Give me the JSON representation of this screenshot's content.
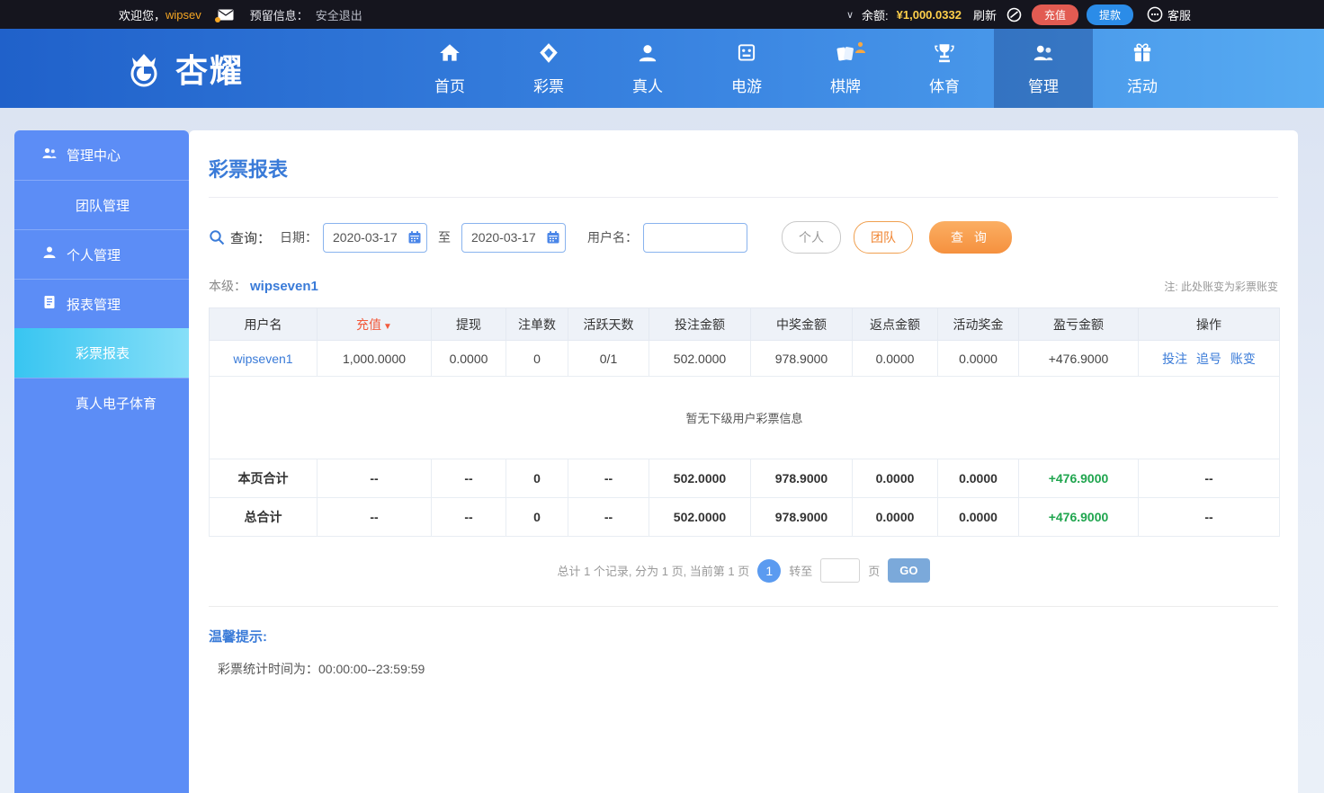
{
  "topbar": {
    "welcome_prefix": "欢迎您，",
    "username": "wipsev",
    "envelope_icon": "envelope-icon",
    "reserved_label": "预留信息：",
    "logout_label": "安全退出",
    "chevron": "∨",
    "balance_label": "余额:",
    "balance_value": "¥1,000.0332",
    "refresh_label": "刷新",
    "visibility_icon": "eye-slash-icon",
    "recharge_label": "充值",
    "withdraw_label": "提款",
    "service_label": "客服",
    "colors": {
      "bar_bg": "#15151e",
      "username": "#f5a623",
      "balance": "#ffd04a",
      "recharge_btn": "#e25b52",
      "withdraw_btn": "#2b8ce8"
    }
  },
  "nav": {
    "logo_text": "杏耀",
    "items": [
      {
        "label": "首页",
        "icon": "home-icon",
        "active": false
      },
      {
        "label": "彩票",
        "icon": "lottery-icon",
        "active": false
      },
      {
        "label": "真人",
        "icon": "live-person-icon",
        "active": false
      },
      {
        "label": "电游",
        "icon": "egames-icon",
        "active": false
      },
      {
        "label": "棋牌",
        "icon": "cards-icon",
        "active": false,
        "badge": "hot-person-badge"
      },
      {
        "label": "体育",
        "icon": "trophy-icon",
        "active": false
      },
      {
        "label": "管理",
        "icon": "manage-people-icon",
        "active": true
      },
      {
        "label": "活动",
        "icon": "gift-icon",
        "active": false
      }
    ],
    "colors": {
      "bar_gradient_start": "#2061ca",
      "bar_gradient_end": "#57abf2"
    }
  },
  "sidebar": {
    "items": [
      {
        "label": "管理中心",
        "icon": "team-icon",
        "type": "section",
        "active": false
      },
      {
        "label": "团队管理",
        "type": "sub",
        "active": false
      },
      {
        "label": "个人管理",
        "icon": "person-icon",
        "type": "section",
        "active": false
      },
      {
        "label": "报表管理",
        "icon": "report-icon",
        "type": "section",
        "active": false
      },
      {
        "label": "彩票报表",
        "type": "sub",
        "active": true
      },
      {
        "label": "真人电子体育",
        "type": "sub",
        "active": false
      }
    ],
    "colors": {
      "bg": "#5c8df6",
      "active_gradient": "#38c5f1"
    }
  },
  "main": {
    "title": "彩票报表",
    "query": {
      "search_icon": "search-icon",
      "label": "查询：",
      "date_label": "日期：",
      "date_from": "2020-03-17",
      "to_label": "至",
      "date_to": "2020-03-17",
      "calendar_icon": "calendar-icon",
      "username_label": "用户名：",
      "username_value": "",
      "btn_personal": "个人",
      "btn_team": "团队",
      "btn_search": "查 询"
    },
    "level_label": "本级：",
    "level_user": "wipseven1",
    "note": "注: 此处账变为彩票账变",
    "table": {
      "headers": [
        "用户名",
        "充值",
        "提现",
        "注单数",
        "活跃天数",
        "投注金额",
        "中奖金额",
        "返点金额",
        "活动奖金",
        "盈亏金额",
        "操作"
      ],
      "sort_icon": "▼",
      "rows": [
        {
          "username": "wipseven1",
          "recharge": "1,000.0000",
          "withdraw": "0.0000",
          "bet_count": "0",
          "active_days": "0/1",
          "bet_amount": "502.0000",
          "win_amount": "978.9000",
          "rebate": "0.0000",
          "activity_bonus": "0.0000",
          "profit": "+476.9000",
          "action_bet": "投注",
          "action_chase": "追号",
          "action_change": "账变"
        }
      ],
      "empty_text": "暂无下级用户彩票信息",
      "page_total": {
        "label": "本页合计",
        "cells": [
          "--",
          "--",
          "0",
          "--",
          "502.0000",
          "978.9000",
          "0.0000",
          "0.0000",
          "+476.9000",
          "--"
        ]
      },
      "grand_total": {
        "label": "总合计",
        "cells": [
          "--",
          "--",
          "0",
          "--",
          "502.0000",
          "978.9000",
          "0.0000",
          "0.0000",
          "+476.9000",
          "--"
        ]
      },
      "colors": {
        "header_bg": "#eef2f8",
        "profit_green": "#1fa54e",
        "sort_orange": "#f25a3c",
        "link_blue": "#3a7bd8"
      }
    },
    "pagination": {
      "summary": "总计 1 个记录, 分为 1 页, 当前第 1 页",
      "current_page": "1",
      "goto_label": "转至",
      "goto_value": "",
      "page_label": "页",
      "go_label": "GO"
    },
    "tips": {
      "title": "温馨提示:",
      "line": "彩票统计时间为：00:00:00--23:59:59"
    }
  }
}
